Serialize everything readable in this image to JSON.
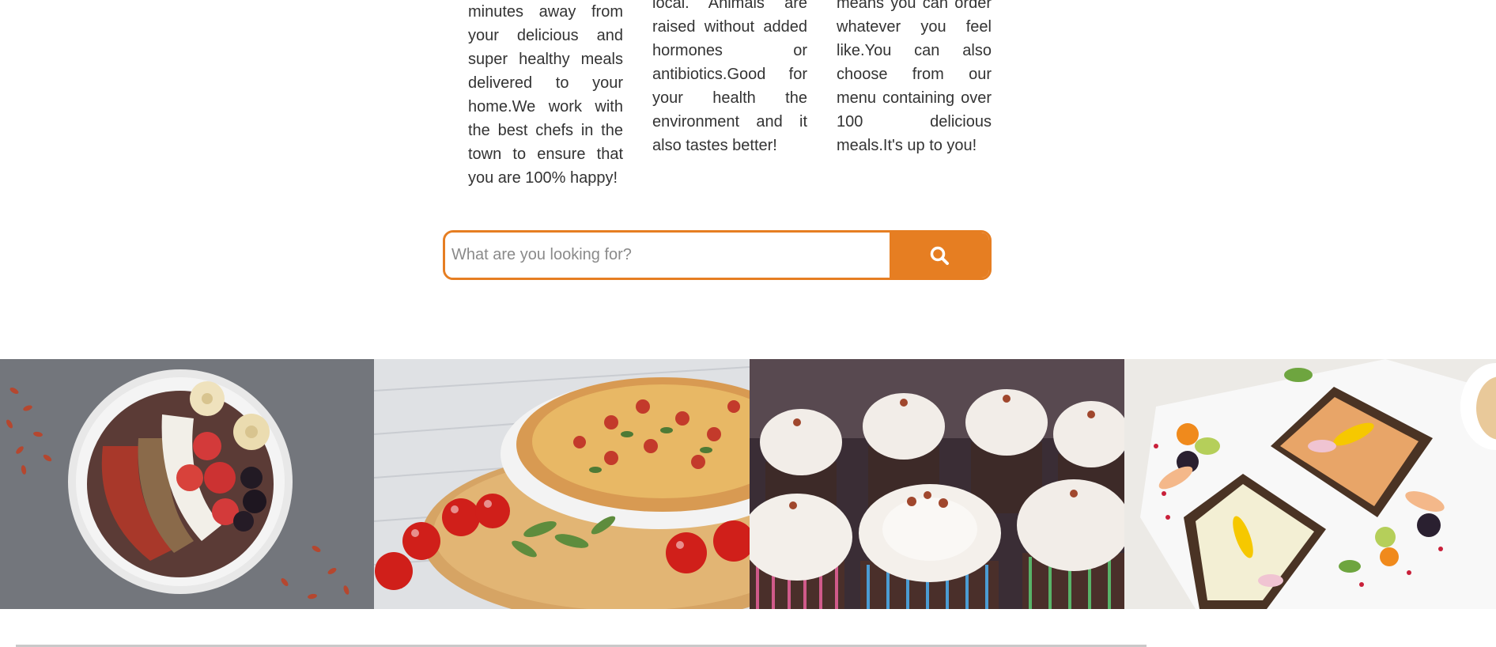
{
  "features": {
    "col1_text": "minutes away from your delicious and super healthy meals delivered to your home.We work with the best chefs in the town to ensure that you are 100% happy!",
    "col2_text": "local. Animals are raised without added hormones or antibiotics.Good for your health the environment and it also tastes better!",
    "col3_text": "means you can order whatever you feel like.You can also choose from our menu containing over 100 delicious meals.It's up to you!"
  },
  "search": {
    "placeholder": "What are you looking for?",
    "value": "",
    "button_icon": "search-icon"
  },
  "gallery": {
    "photos": [
      {
        "name": "smoothie-bowl-photo"
      },
      {
        "name": "pizza-photo"
      },
      {
        "name": "cupcakes-photo"
      },
      {
        "name": "open-sandwiches-photo"
      }
    ]
  },
  "colors": {
    "accent": "#e67e22",
    "text": "#333333",
    "placeholder": "#8a8a8a"
  }
}
